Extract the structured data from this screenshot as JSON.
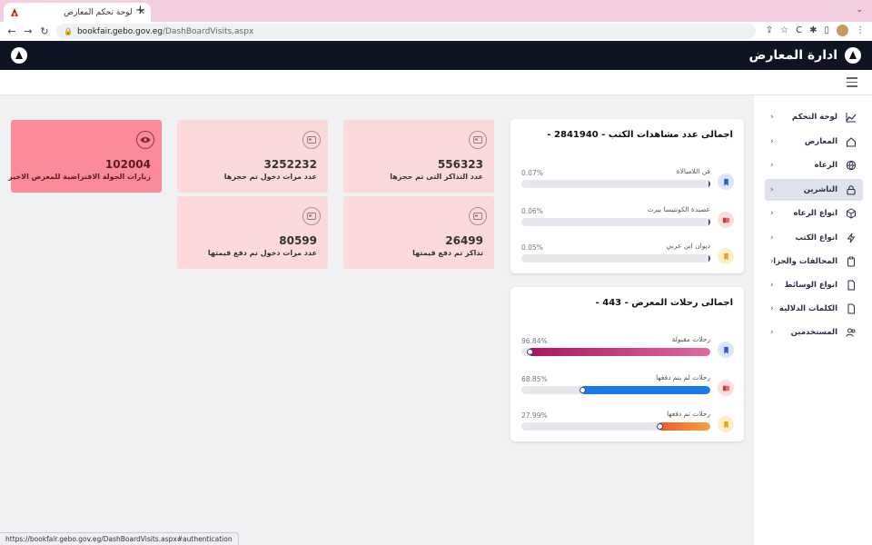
{
  "browser": {
    "tab_title": "لوحة تحكم المعارض",
    "url_host": "bookfair.gebo.gov.eg",
    "url_path": "/DashBoardVisits.aspx",
    "status_url": "https://bookfair.gebo.gov.eg/DashBoardVisits.aspx#authentication"
  },
  "header": {
    "title": "ادارة المعارض"
  },
  "sidebar": {
    "items": [
      {
        "label": "لوحة التحكم",
        "icon": "chart-icon"
      },
      {
        "label": "المعارض",
        "icon": "home-icon"
      },
      {
        "label": "الرعاه",
        "icon": "globe-icon"
      },
      {
        "label": "الناشرين",
        "icon": "lock-icon"
      },
      {
        "label": "انواع الرعاه",
        "icon": "box-icon"
      },
      {
        "label": "انواع الكتب",
        "icon": "bolt-icon"
      },
      {
        "label": "المخالفات والجزاءات",
        "icon": "clipboard-icon"
      },
      {
        "label": "انواع الوسائط",
        "icon": "file-icon"
      },
      {
        "label": "الكلمات الدلالية",
        "icon": "file-icon"
      },
      {
        "label": "المستخدمين",
        "icon": "users-icon"
      }
    ],
    "active_index": 3
  },
  "books_card": {
    "title": "اجمالى عدد مشاهدات الكتب - 2841940 -",
    "rows": [
      {
        "label": "فن اللامبالاة",
        "pct_text": "0.07%",
        "pct": 0.07,
        "icon": "bookmark-icon",
        "tone": "blue"
      },
      {
        "label": "عصيدة الكونتيسا بيرت",
        "pct_text": "0.06%",
        "pct": 0.06,
        "icon": "card-icon",
        "tone": "red"
      },
      {
        "label": "ديوان ابن عربي",
        "pct_text": "0.05%",
        "pct": 0.05,
        "icon": "bookmark-icon",
        "tone": "yellow"
      }
    ]
  },
  "trips_card": {
    "title": "اجمالى رحلات المعرض - 443 -",
    "rows": [
      {
        "label": "رحلات مقبولة",
        "pct_text": "96.84%",
        "pct": 96.84,
        "icon": "bookmark-icon",
        "tone": "blue",
        "bar": "pink"
      },
      {
        "label": "رحلات لم يتم دفعها",
        "pct_text": "68.85%",
        "pct": 68.85,
        "icon": "card-icon",
        "tone": "red",
        "bar": "blue"
      },
      {
        "label": "رحلات تم دفعها",
        "pct_text": "27.99%",
        "pct": 27.99,
        "icon": "bookmark-icon",
        "tone": "yellow",
        "bar": "orange"
      }
    ]
  },
  "tiles": [
    {
      "value": "556323",
      "label": "عدد التذاكر التى تم حجزها",
      "icon": "card-icon"
    },
    {
      "value": "3252232",
      "label": "عدد مرات دخول تم حجزها",
      "icon": "card-icon"
    },
    {
      "value": "102004",
      "label": "زيارات الجولة الافتراضية للمعرض الاخير",
      "icon": "eye-icon",
      "highlight": true
    },
    {
      "value": "26499",
      "label": "تذاكر تم دفع قيمتها",
      "icon": "card-icon"
    },
    {
      "value": "80599",
      "label": "عدد مرات دخول تم دفع قيمتها",
      "icon": "card-icon"
    }
  ],
  "colors": {
    "header_bg": "#0f1422",
    "tile_bg": "#fcdadb",
    "tile_highlight_bg": "#fb8b9a",
    "bar_pink": "#b8236e",
    "bar_blue": "#1a7ae8",
    "bar_orange": "#f27a32"
  }
}
